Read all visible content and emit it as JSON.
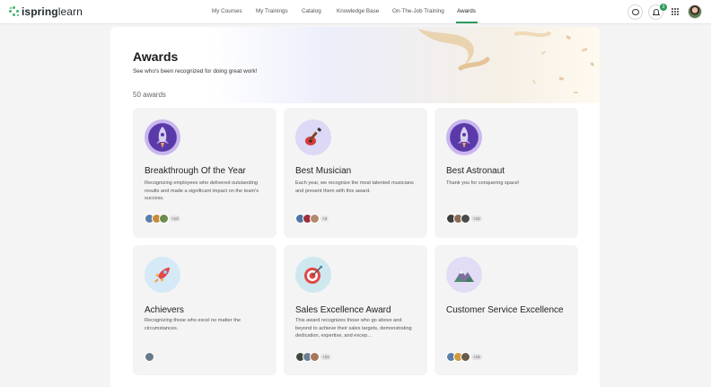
{
  "app": {
    "logo_text_bold": "ispring",
    "logo_text_light": "learn"
  },
  "nav": {
    "items": [
      "My Courses",
      "My Trainings",
      "Catalog",
      "Knowledge Base",
      "On-The-Job Training",
      "Awards"
    ],
    "active": "Awards"
  },
  "header_icons": {
    "notifications_count": "3"
  },
  "page": {
    "title": "Awards",
    "subtitle": "See who's been recognized for doing great work!",
    "count_label": "50 awards"
  },
  "awards": [
    {
      "title": "Breakthrough Of the Year",
      "description": "Recognizing employees who delivered outstanding results and made a significant impact on the team's success.",
      "icon": "rocket-medal-icon",
      "more": "+13"
    },
    {
      "title": "Best Musician",
      "description": "Each year, we recognize the most talented musicians and present them with this award.",
      "icon": "guitar-icon",
      "more": "+3"
    },
    {
      "title": "Best Astronaut",
      "description": "Thank you for conquering space!",
      "icon": "rocket-medal-icon",
      "more": "+10"
    },
    {
      "title": "Achievers",
      "description": "Recognizing those who excel no matter the circumstances.",
      "icon": "rocket-icon",
      "more": ""
    },
    {
      "title": "Sales Excellence Award",
      "description": "This award recognizes those who go above and beyond to achieve their sales targets, demonstrating dedication, expertise, and excep...",
      "icon": "target-icon",
      "more": "+21"
    },
    {
      "title": "Customer Service Excellence",
      "description": "",
      "icon": "mountain-icon",
      "more": "+19"
    }
  ],
  "colors": {
    "accent": "#2e9b5b",
    "card_bg": "#f4f4f4",
    "page_bg": "#f4f4f5"
  }
}
